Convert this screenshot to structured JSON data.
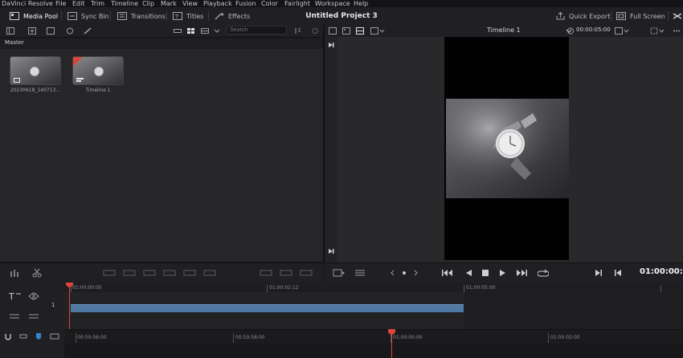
{
  "menu": [
    "DaVinci Resolve",
    "File",
    "Edit",
    "Trim",
    "Timeline",
    "Clip",
    "Mark",
    "View",
    "Playback",
    "Fusion",
    "Color",
    "Fairlight",
    "Workspace",
    "Help"
  ],
  "toolbar": {
    "media_pool": "Media Pool",
    "sync_bin": "Sync Bin",
    "transitions": "Transitions",
    "titles": "Titles",
    "effects": "Effects",
    "project_title": "Untitled Project 3",
    "quick_export": "Quick Export",
    "full_screen": "Full Screen"
  },
  "media_pool": {
    "search_placeholder": "Search",
    "bin_label": "Master",
    "clips": [
      {
        "label": "20230618_140713..."
      },
      {
        "label": "Timeline 1"
      }
    ]
  },
  "viewer": {
    "timeline_name": "Timeline 1",
    "duration": "00:00:05:00",
    "current_timecode": "01:00:00:00"
  },
  "timeline": {
    "ruler_upper": [
      "01:00:00:00",
      "01:00:02:12",
      "01:00:05:00"
    ],
    "track_number": "1",
    "ruler_lower": [
      "00:59:56:00",
      "00:59:58:00",
      "01:00:00:00",
      "01:00:02:00"
    ]
  },
  "colors": {
    "accent_blue": "#4f78a3",
    "playhead_red": "#e0443a",
    "background": "#1b1b1f"
  }
}
